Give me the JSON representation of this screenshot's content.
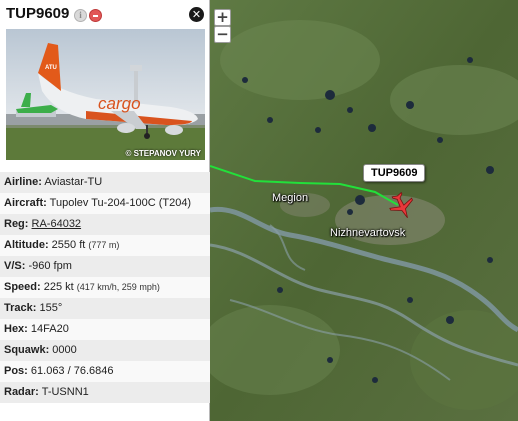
{
  "flight": {
    "callsign": "TUP9609",
    "photo_credit": "© STEPANOV YURY",
    "photo_livery_text": "cargo",
    "photo_logo_text": "ATU"
  },
  "details": {
    "airline": {
      "label": "Airline:",
      "value": "Aviastar-TU"
    },
    "aircraft": {
      "label": "Aircraft:",
      "value": "Tupolev Tu-204-100C (T204)"
    },
    "reg": {
      "label": "Reg:",
      "value": "RA-64032"
    },
    "altitude": {
      "label": "Altitude:",
      "value": "2550 ft",
      "extra": "(777 m)"
    },
    "vs": {
      "label": "V/S:",
      "value": "-960 fpm"
    },
    "speed": {
      "label": "Speed:",
      "value": "225 kt",
      "extra": "(417 km/h, 259 mph)"
    },
    "track": {
      "label": "Track:",
      "value": "155°"
    },
    "hex": {
      "label": "Hex:",
      "value": "14FA20"
    },
    "squawk": {
      "label": "Squawk:",
      "value": "0000"
    },
    "pos": {
      "label": "Pos:",
      "value": "61.063 / 76.6846"
    },
    "radar": {
      "label": "Radar:",
      "value": "T-USNN1"
    }
  },
  "map": {
    "zoom_in": "+",
    "zoom_out": "−",
    "labels": {
      "megion": "Megion",
      "nizhnevartovsk": "Nizhnevartovsk"
    },
    "flight_tag": "TUP9609",
    "track_color": "#22e03a",
    "plane_color": "#e8383b"
  },
  "icons": {
    "info": "i",
    "close": "✕"
  }
}
